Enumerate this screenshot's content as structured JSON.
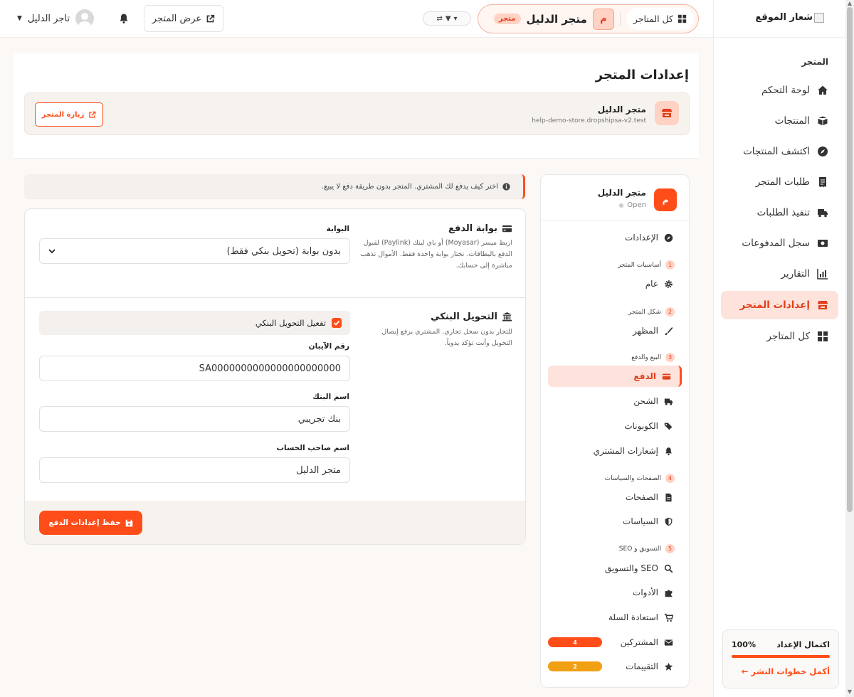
{
  "sidebar": {
    "logo_text": "شعار الموقع",
    "section_title": "المتجر",
    "items": [
      {
        "label": "لوحة التحكم",
        "icon": "home-icon"
      },
      {
        "label": "المنتجات",
        "icon": "box-icon"
      },
      {
        "label": "اكتشف المنتجات",
        "icon": "compass-icon"
      },
      {
        "label": "طلبات المتجر",
        "icon": "receipt-icon"
      },
      {
        "label": "تنفيذ الطلبات",
        "icon": "truck-icon"
      },
      {
        "label": "سجل المدفوعات",
        "icon": "money-icon"
      },
      {
        "label": "التقارير",
        "icon": "chart-icon"
      },
      {
        "label": "إعدادات المتجر",
        "icon": "store-icon",
        "active": true
      },
      {
        "label": "كل المتاجر",
        "icon": "grid-icon"
      }
    ],
    "progress": {
      "title": "اكتمال الإعداد",
      "value_text": "100%",
      "value": 1.0,
      "link": "أكمل خطوات النشر ←"
    }
  },
  "topbar": {
    "all_stores": "كل المتاجر",
    "store_initial": "م",
    "store_name": "متجر الدليل",
    "store_badge": "متجر",
    "view_store": "عرض المتجر",
    "user_name": "تاجر الدليل"
  },
  "header": {
    "title": "إعدادات المتجر",
    "store_name": "متجر الدليل",
    "store_url": "help-demo-store.dropshipsa-v2.test",
    "visit_button": "زيارة المتجر"
  },
  "settings_nav": {
    "store_initial": "م",
    "store_name": "متجر الدليل",
    "status": "Open",
    "top_item": "الإعدادات",
    "groups": [
      {
        "num": "1",
        "title": "أساسيات المتجر"
      },
      {
        "num": "2",
        "title": "شكل المتجر"
      },
      {
        "num": "3",
        "title": "البيع والدفع"
      },
      {
        "num": "4",
        "title": "الصفحات والسياسات"
      },
      {
        "num": "5",
        "title": "التسويق و SEO"
      }
    ],
    "items": {
      "general": "عام",
      "appearance": "المظهر",
      "payment": "الدفع",
      "shipping": "الشحن",
      "coupons": "الكوبونات",
      "notifications": "إشعارات المشتري",
      "pages": "الصفحات",
      "policies": "السياسات",
      "seo": "SEO والتسويق",
      "tools": "الأدوات",
      "cart_recovery": "استعادة السلة",
      "subscribers": "المشتركين",
      "reviews": "التقييمات"
    },
    "badges": {
      "subscribers": "4",
      "reviews": "2"
    },
    "colors": {
      "subscribers_badge": "#ff4d1a",
      "reviews_badge": "#f0a012"
    }
  },
  "info_text": "اختر كيف يدفع لك المشتري. المتجر بدون طريقة دفع لا يبيع.",
  "gateway": {
    "title": "بوابة الدفع",
    "description": "اربط ميسر (Moyasar) أو باي لينك (Paylink) لقبول الدفع بالبطاقات. تختار بوابة واحدة فقط. الأموال تذهب مباشرة إلى حسابك.",
    "field_label": "البوابة",
    "selected": "بدون بوابة (تحويل بنكي فقط)"
  },
  "bank": {
    "title": "التحويل البنكي",
    "description": "للتجار بدون سجل تجاري. المشتري يرفع إيصال التحويل وأنت تؤكد يدوياً.",
    "enable_label": "تفعيل التحويل البنكي",
    "enabled": true,
    "iban_label": "رقم الآيبان",
    "iban_value": "SA0000000000000000000000",
    "bank_label": "اسم البنك",
    "bank_value": "بنك تجريبي",
    "holder_label": "اسم صاحب الحساب",
    "holder_value": "متجر الدليل"
  },
  "save_button": "حفظ إعدادات الدفع",
  "colors": {
    "accent": "#ff4d1a",
    "accent_light": "#fde3dc"
  }
}
